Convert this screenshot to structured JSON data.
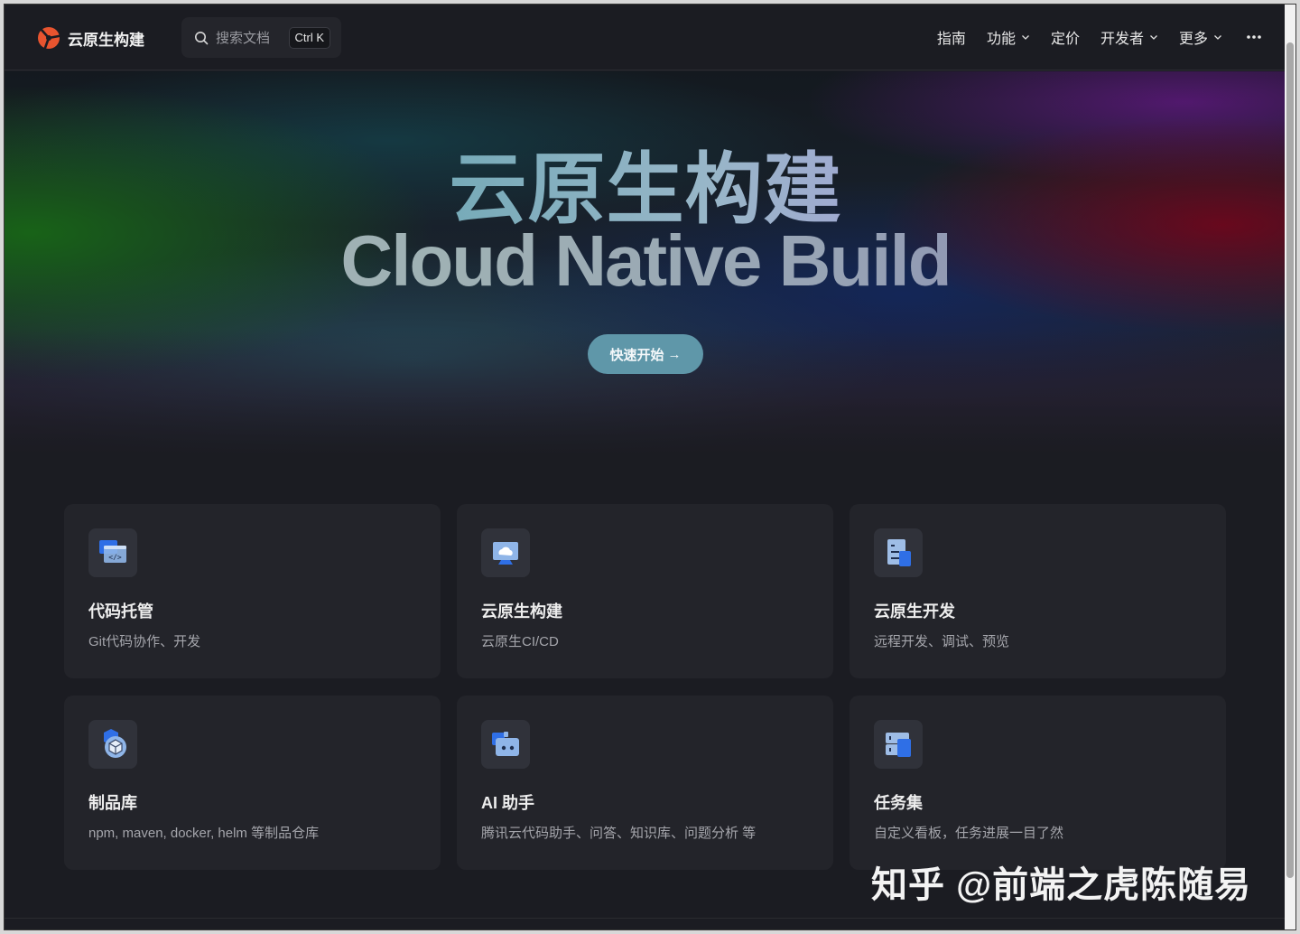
{
  "header": {
    "brand_name": "云原生构建",
    "search": {
      "placeholder": "搜索文档",
      "shortcut": "Ctrl K"
    },
    "nav": [
      {
        "label": "指南",
        "has_dropdown": false
      },
      {
        "label": "功能",
        "has_dropdown": true
      },
      {
        "label": "定价",
        "has_dropdown": false
      },
      {
        "label": "开发者",
        "has_dropdown": true
      },
      {
        "label": "更多",
        "has_dropdown": true
      }
    ],
    "more_icon": "ellipsis-icon"
  },
  "hero": {
    "title": "云原生构建",
    "subtitle": "Cloud Native Build",
    "cta_label": "快速开始",
    "cta_arrow": "→"
  },
  "features": [
    {
      "title": "代码托管",
      "desc": "Git代码协作、开发",
      "icon": "code-window-icon"
    },
    {
      "title": "云原生构建",
      "desc": "云原生CI/CD",
      "icon": "cloud-monitor-icon"
    },
    {
      "title": "云原生开发",
      "desc": "远程开发、调试、预览",
      "icon": "document-list-icon"
    },
    {
      "title": "制品库",
      "desc": "npm, maven, docker, helm 等制品仓库",
      "icon": "package-cube-icon"
    },
    {
      "title": "AI 助手",
      "desc": "腾讯云代码助手、问答、知识库、问题分析 等",
      "icon": "robot-icon"
    },
    {
      "title": "任务集",
      "desc": "自定义看板，任务进展一目了然",
      "icon": "task-board-icon"
    }
  ],
  "watermark": "知乎 @前端之虎陈随易",
  "colors": {
    "accent": "#5f97a9",
    "background": "#1b1c22",
    "card": "#23242a",
    "logo": "#e8542f"
  }
}
